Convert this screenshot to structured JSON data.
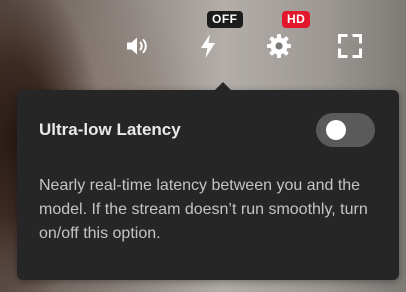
{
  "toolbar": {
    "volume_icon": "volume-icon",
    "latency_icon": "lightning-bolt-icon",
    "latency_badge": "OFF",
    "settings_icon": "gear-icon",
    "quality_badge": "HD",
    "fullscreen_icon": "fullscreen-icon"
  },
  "popover": {
    "title": "Ultra-low Latency",
    "toggle_state": "off",
    "description": "Nearly real-time latency between you and the model. If the stream doesn’t run smoothly, turn on/off this option."
  },
  "colors": {
    "popover_bg": "#262626",
    "badge_off_bg": "#1c1c1c",
    "badge_hd_bg": "#e3162b",
    "toggle_track": "#5a5a5a",
    "text_primary": "#e9e9e9",
    "text_secondary": "#c4c4c4"
  }
}
